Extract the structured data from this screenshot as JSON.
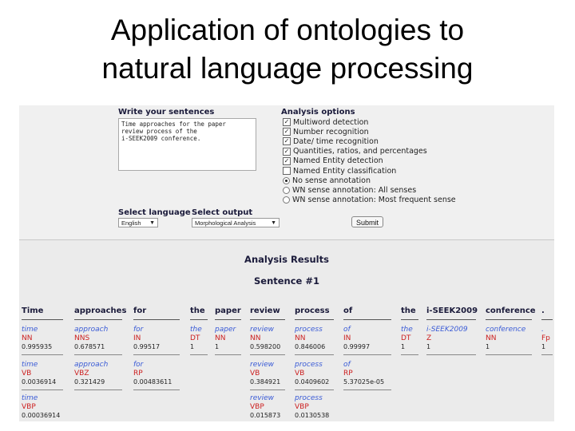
{
  "slide": {
    "title_line1": "Application of ontologies to",
    "title_line2": "natural language processing"
  },
  "form": {
    "sentences_label": "Write your sentences",
    "sentences_lines": [
      "Time approaches for the paper",
      "review process of the",
      "i-SEEK2009 conference."
    ],
    "options_label": "Analysis options",
    "options": [
      {
        "label": "Multiword detection",
        "checked": true
      },
      {
        "label": "Number recognition",
        "checked": true
      },
      {
        "label": "Date/ time recognition",
        "checked": true
      },
      {
        "label": "Quantities, ratios, and percentages",
        "checked": true
      },
      {
        "label": "Named Entity detection",
        "checked": true
      },
      {
        "label": "Named Entity classification",
        "checked": false
      }
    ],
    "radios": [
      {
        "label": "No sense annotation",
        "selected": true
      },
      {
        "label": "WN sense annotation: All senses",
        "selected": false
      },
      {
        "label": "WN sense annotation: Most frequent sense",
        "selected": false
      }
    ],
    "language_label": "Select language",
    "language_value": "English",
    "output_label": "Select output",
    "output_value": "Morphological Analysis",
    "submit_label": "Submit"
  },
  "results": {
    "title": "Analysis Results",
    "sentence_label": "Sentence #1",
    "headers": [
      "Time",
      "approaches",
      "for",
      "the",
      "paper",
      "review",
      "process",
      "of",
      "the",
      "i-SEEK2009",
      "conference",
      "."
    ],
    "rows": [
      [
        [
          "time",
          "NN",
          "0.995935"
        ],
        [
          "approach",
          "NNS",
          "0.678571"
        ],
        [
          "for",
          "IN",
          "0.99517"
        ],
        [
          "the",
          "DT",
          "1"
        ],
        [
          "paper",
          "NN",
          "1"
        ],
        [
          "review",
          "NN",
          "0.598200"
        ],
        [
          "process",
          "NN",
          "0.846006"
        ],
        [
          "of",
          "IN",
          "0.99997"
        ],
        [
          "the",
          "DT",
          "1"
        ],
        [
          "i-SEEK2009",
          "Z",
          "1"
        ],
        [
          "conference",
          "NN",
          "1"
        ],
        [
          ".",
          "Fp",
          "1"
        ]
      ],
      [
        [
          "time",
          "VB",
          "0.0036914"
        ],
        [
          "approach",
          "VBZ",
          "0.321429"
        ],
        [
          "for",
          "RP",
          "0.00483611"
        ],
        null,
        null,
        [
          "review",
          "VB",
          "0.384921"
        ],
        [
          "process",
          "VB",
          "0.0409602"
        ],
        [
          "of",
          "RP",
          "5.37025e-05"
        ],
        null,
        null,
        null,
        null
      ],
      [
        [
          "time",
          "VBP",
          "0.00036914"
        ],
        null,
        null,
        null,
        null,
        [
          "review",
          "VBP",
          "0.015873"
        ],
        [
          "process",
          "VBP",
          "0.0130538"
        ],
        null,
        null,
        null,
        null,
        null
      ]
    ]
  }
}
